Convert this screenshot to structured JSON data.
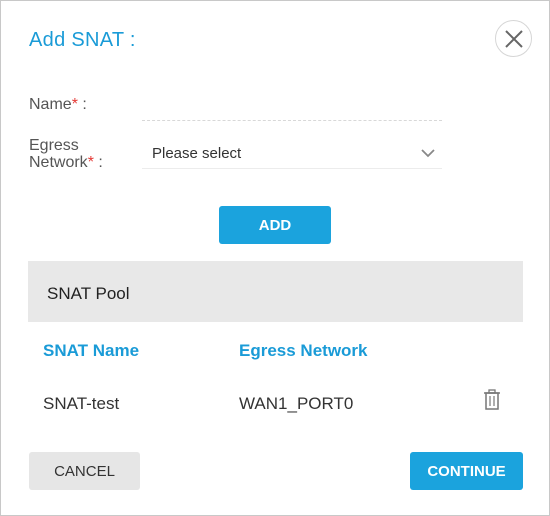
{
  "dialog": {
    "title": "Add SNAT :",
    "close_icon": "close-icon"
  },
  "form": {
    "name_label": "Name",
    "name_value": "",
    "name_placeholder": "",
    "egress_label_line1": "Egress",
    "egress_label_line2": "Network",
    "required_mark": "*",
    "label_suffix": " :",
    "egress_select_value": "Please select",
    "dropdown_icon": "chevron-down-icon"
  },
  "buttons": {
    "add": "ADD",
    "cancel": "CANCEL",
    "continue": "CONTINUE"
  },
  "pool": {
    "title": "SNAT Pool",
    "columns": [
      "SNAT Name",
      "Egress Network"
    ],
    "rows": [
      {
        "snat_name": "SNAT-test",
        "egress_network": "WAN1_PORT0",
        "action_icon": "trash-icon"
      }
    ]
  },
  "colors": {
    "accent": "#1a9bd7",
    "button_primary": "#1ba3dd",
    "required": "#e53935",
    "pool_header_bg": "#e8e8e8"
  }
}
